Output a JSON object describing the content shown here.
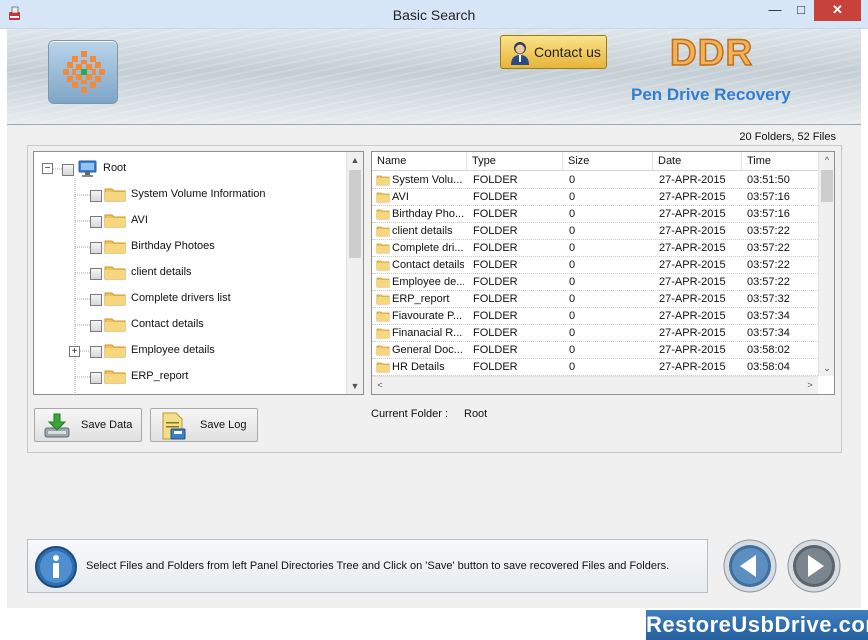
{
  "window": {
    "title": "Basic Search"
  },
  "header": {
    "contact_label": "Contact us",
    "brand": "DDR",
    "product": "Pen Drive Recovery"
  },
  "summary": "20 Folders, 52 Files",
  "tree": {
    "root_label": "Root",
    "items": [
      {
        "label": "System Volume Information",
        "expandable": false
      },
      {
        "label": "AVI",
        "expandable": false
      },
      {
        "label": "Birthday Photoes",
        "expandable": false
      },
      {
        "label": "client details",
        "expandable": false
      },
      {
        "label": "Complete drivers list",
        "expandable": false
      },
      {
        "label": "Contact details",
        "expandable": false
      },
      {
        "label": "Employee details",
        "expandable": true
      },
      {
        "label": "ERP_report",
        "expandable": false
      }
    ]
  },
  "listview": {
    "columns": [
      "Name",
      "Type",
      "Size",
      "Date",
      "Time"
    ],
    "rows": [
      {
        "name": "System Volu...",
        "type": "FOLDER",
        "size": "0",
        "date": "27-APR-2015",
        "time": "03:51:50"
      },
      {
        "name": "AVI",
        "type": "FOLDER",
        "size": "0",
        "date": "27-APR-2015",
        "time": "03:57:16"
      },
      {
        "name": "Birthday Pho...",
        "type": "FOLDER",
        "size": "0",
        "date": "27-APR-2015",
        "time": "03:57:16"
      },
      {
        "name": "client details",
        "type": "FOLDER",
        "size": "0",
        "date": "27-APR-2015",
        "time": "03:57:22"
      },
      {
        "name": "Complete dri...",
        "type": "FOLDER",
        "size": "0",
        "date": "27-APR-2015",
        "time": "03:57:22"
      },
      {
        "name": "Contact details",
        "type": "FOLDER",
        "size": "0",
        "date": "27-APR-2015",
        "time": "03:57:22"
      },
      {
        "name": "Employee de...",
        "type": "FOLDER",
        "size": "0",
        "date": "27-APR-2015",
        "time": "03:57:22"
      },
      {
        "name": "ERP_report",
        "type": "FOLDER",
        "size": "0",
        "date": "27-APR-2015",
        "time": "03:57:32"
      },
      {
        "name": "Fiavourate P...",
        "type": "FOLDER",
        "size": "0",
        "date": "27-APR-2015",
        "time": "03:57:34"
      },
      {
        "name": "Finanacial R...",
        "type": "FOLDER",
        "size": "0",
        "date": "27-APR-2015",
        "time": "03:57:34"
      },
      {
        "name": "General Doc...",
        "type": "FOLDER",
        "size": "0",
        "date": "27-APR-2015",
        "time": "03:58:02"
      },
      {
        "name": "HR Details",
        "type": "FOLDER",
        "size": "0",
        "date": "27-APR-2015",
        "time": "03:58:04"
      }
    ]
  },
  "actions": {
    "save_data": "Save Data",
    "save_log": "Save Log"
  },
  "current_folder": {
    "label": "Current Folder :",
    "value": "Root"
  },
  "hint": "Select Files and Folders from left Panel Directories Tree and Click on 'Save' button to save recovered Files and Folders.",
  "footer": "RestoreUsbDrive.com"
}
